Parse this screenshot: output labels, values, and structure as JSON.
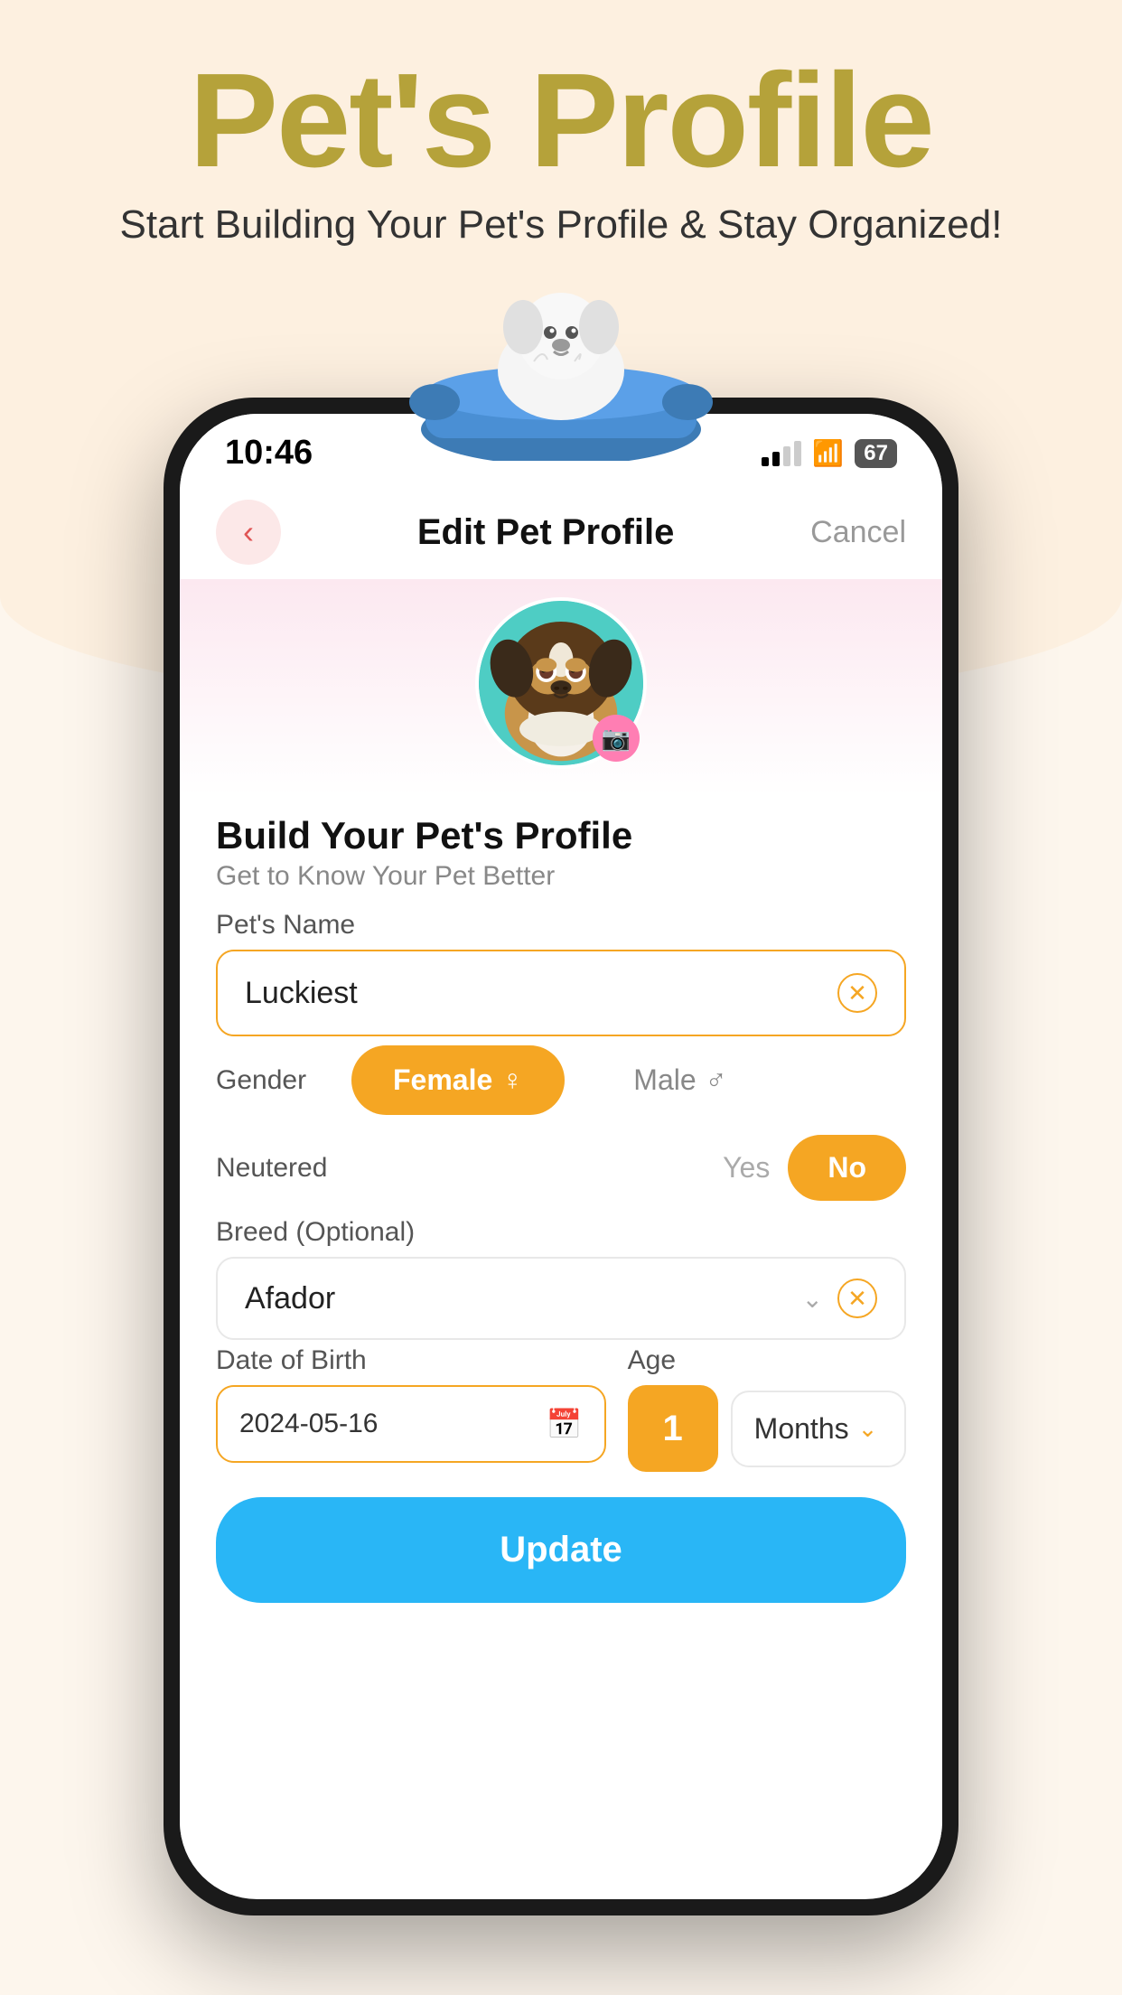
{
  "app": {
    "title": "Pet's Profile",
    "subtitle": "Start Building Your Pet's Profile & Stay Organized!",
    "status_time": "10:46"
  },
  "nav": {
    "back_label": "‹",
    "page_title": "Edit Pet Profile",
    "cancel_label": "Cancel"
  },
  "profile": {
    "section_title": "Build Your Pet's Profile",
    "section_subtitle": "Get to Know Your Pet Better"
  },
  "form": {
    "pet_name_label": "Pet's Name",
    "pet_name_value": "Luckiest",
    "gender_label": "Gender",
    "gender_female": "Female",
    "gender_male": "Male",
    "neutered_label": "Neutered",
    "neutered_yes": "Yes",
    "neutered_no": "No",
    "breed_label": "Breed (Optional)",
    "breed_value": "Afador",
    "dob_label": "Date of Birth",
    "dob_value": "2024-05-16",
    "age_label": "Age",
    "age_value": "1",
    "age_unit": "Months",
    "update_label": "Update"
  },
  "icons": {
    "back": "‹",
    "camera": "📷",
    "clear": "✕",
    "chevron_down": "⌄",
    "calendar": "📅",
    "female_symbol": "♀",
    "male_symbol": "♂"
  },
  "colors": {
    "accent_orange": "#f5a623",
    "accent_blue": "#29b6f6",
    "accent_pink": "#fce8f0",
    "back_btn_bg": "#fce8e8",
    "back_arrow": "#e05555"
  }
}
